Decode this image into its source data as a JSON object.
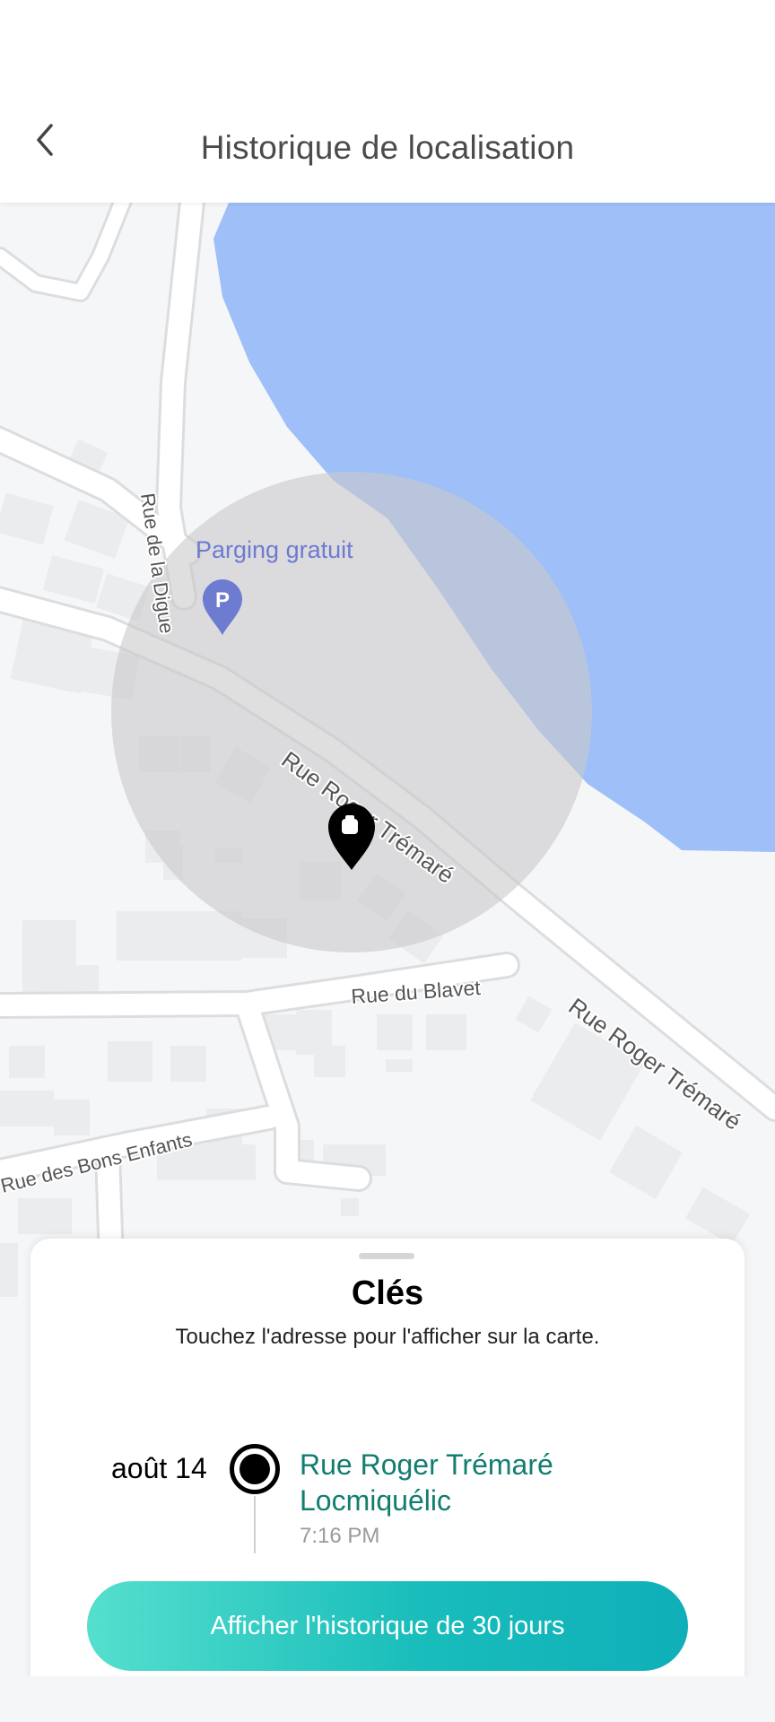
{
  "header": {
    "title": "Historique de localisation",
    "back_icon": "chevron-left-icon"
  },
  "map": {
    "poi_label": "Parging gratuit",
    "poi_icon": "parking-pin-icon",
    "poi_icon_letter": "P",
    "street_labels": {
      "digue": "Rue de la Digue",
      "tremare_main": "Rue Roger Trémaré",
      "tremare_right": "Rue Roger Trémaré",
      "blavet": "Rue du Blavet",
      "bons_enfants": "Rue des Bons Enfants"
    },
    "marker_icon": "key-location-pin-icon",
    "colors": {
      "water": "#9ebff8",
      "radius": "#d4d5d6",
      "road": "#ffffff",
      "poi": "#6d7bd0"
    }
  },
  "sheet": {
    "title": "Clés",
    "subtitle": "Touchez l'adresse pour l'afficher sur la carte.",
    "entry": {
      "date": "août 14",
      "address_line1": "Rue Roger Trémaré",
      "address_line2": "Locmiquélic",
      "time": "7:16 PM"
    },
    "button_label": "Afficher l'historique de 30 jours",
    "colors": {
      "address": "#127d70",
      "button_start": "#55dfcd",
      "button_end": "#0fafb9"
    }
  }
}
